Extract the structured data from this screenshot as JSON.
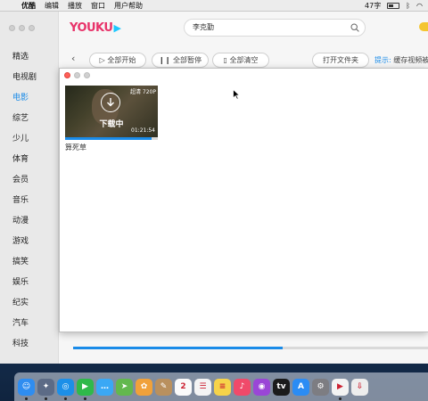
{
  "menubar": {
    "app_name": "优酷",
    "items": [
      "编辑",
      "播放",
      "窗口",
      "用户帮助"
    ],
    "battery_text": "47字"
  },
  "sidebar": {
    "items": [
      {
        "label": "精选"
      },
      {
        "label": "电视剧"
      },
      {
        "label": "电影",
        "active": true
      },
      {
        "label": "综艺"
      },
      {
        "label": "少儿"
      },
      {
        "label": "体育"
      },
      {
        "label": "会员"
      },
      {
        "label": "音乐"
      },
      {
        "label": "动漫"
      },
      {
        "label": "游戏"
      },
      {
        "label": "搞笑"
      },
      {
        "label": "娱乐"
      },
      {
        "label": "纪实"
      },
      {
        "label": "汽车"
      },
      {
        "label": "科技"
      }
    ]
  },
  "header": {
    "logo": "YOUKU",
    "search_value": "李克勤"
  },
  "toolbar": {
    "start_all": "全部开始",
    "pause_all": "全部暂停",
    "clear_all": "全部清空",
    "open_folder": "打开文件夹",
    "tip_label": "提示:",
    "tip_text": "缓存视频被"
  },
  "download_item": {
    "status": "下载中",
    "quality": "超清 720P",
    "duration": "01:21:54",
    "title": "算死草",
    "progress": 0.93
  },
  "bottom_progress": 0.59,
  "colors": {
    "accent": "#1a8be8",
    "brand_pink": "#e8336a",
    "brand_cyan": "#1ec8ff"
  },
  "dock": {
    "icons": [
      {
        "name": "finder-icon",
        "color": "#2f8df0",
        "glyph": "☺"
      },
      {
        "name": "launchpad-icon",
        "color": "#5c6b86",
        "glyph": "✦"
      },
      {
        "name": "safari-icon",
        "color": "#1c8fe8",
        "glyph": "◎"
      },
      {
        "name": "facetime-icon",
        "color": "#2fb94a",
        "glyph": "▶"
      },
      {
        "name": "messages-icon",
        "color": "#3aa8f5",
        "glyph": "…"
      },
      {
        "name": "maps-icon",
        "color": "#63b84e",
        "glyph": "➤"
      },
      {
        "name": "photos-icon",
        "color": "#f0a13a",
        "glyph": "✿"
      },
      {
        "name": "notes-app-icon",
        "color": "#b9905e",
        "glyph": "✎"
      },
      {
        "name": "calendar-icon",
        "color": "#fafafa",
        "glyph": "2"
      },
      {
        "name": "reminders-icon",
        "color": "#f4f4f4",
        "glyph": "☰"
      },
      {
        "name": "notes-icon",
        "color": "#f6d34a",
        "glyph": "≡"
      },
      {
        "name": "music-icon",
        "color": "#f04a6a",
        "glyph": "♪"
      },
      {
        "name": "podcasts-icon",
        "color": "#9a46d6",
        "glyph": "◉"
      },
      {
        "name": "appletv-icon",
        "color": "#1b1b1b",
        "glyph": "tv"
      },
      {
        "name": "appstore-icon",
        "color": "#2b8cf4",
        "glyph": "A"
      },
      {
        "name": "system-preferences-icon",
        "color": "#7d7d82",
        "glyph": "⚙"
      },
      {
        "name": "youku-icon",
        "color": "#f3f3f3",
        "glyph": "▶"
      },
      {
        "name": "downloads-icon",
        "color": "#ededed",
        "glyph": "⇩"
      }
    ]
  }
}
